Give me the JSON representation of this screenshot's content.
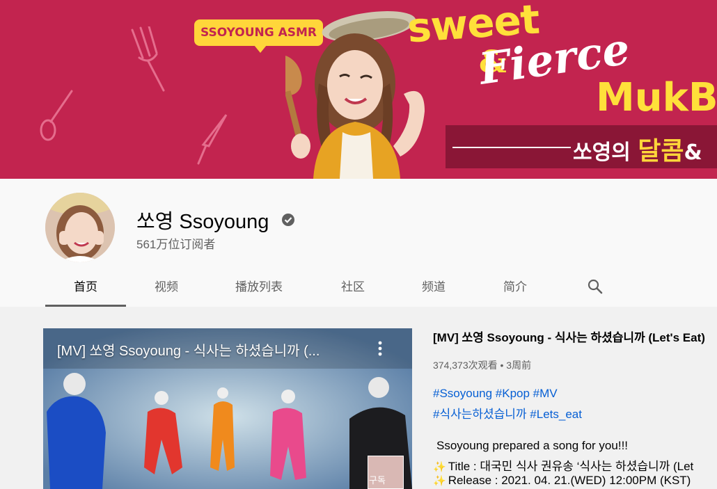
{
  "banner": {
    "badge": "SSOYOUNG ASMR",
    "title_sweet": "sweet",
    "title_amp": "&",
    "title_fierce": "Fierce",
    "title_mukbang": "MukBa",
    "kr_prefix": "쏘영의",
    "kr_highlight": "달콤",
    "kr_suffix": "&",
    "colors": {
      "background": "#c2244f",
      "accent": "#ffd63a"
    }
  },
  "channel": {
    "name": "쏘영 Ssoyoung",
    "subscribers": "561万位订阅者",
    "verified_icon": "verified-check-icon"
  },
  "tabs": [
    {
      "label": "首页",
      "active": true
    },
    {
      "label": "视频",
      "active": false
    },
    {
      "label": "播放列表",
      "active": false
    },
    {
      "label": "社区",
      "active": false
    },
    {
      "label": "频道",
      "active": false
    },
    {
      "label": "简介",
      "active": false
    }
  ],
  "featured": {
    "player_title": "[MV] 쏘영 Ssoyoung - 식사는 하셨습니까 (...",
    "corner_label": "구독",
    "title": "[MV] 쏘영 Ssoyoung - 식사는 하셨습니까 (Let's Eat)",
    "meta": "374,373次观看 • 3周前",
    "tags_line1": "#Ssoyoung #Kpop #MV",
    "tags_line2": "#식사는하셨습니까 #Lets_eat",
    "desc_line1": "Ssoyoung prepared a song for you!!!",
    "desc_line2": "Title : 대국민 식사 권유송 ‘식사는 하셨습니까 (Let",
    "desc_line3": "Release : 2021. 04. 21.(WED) 12:00PM (KST)"
  }
}
